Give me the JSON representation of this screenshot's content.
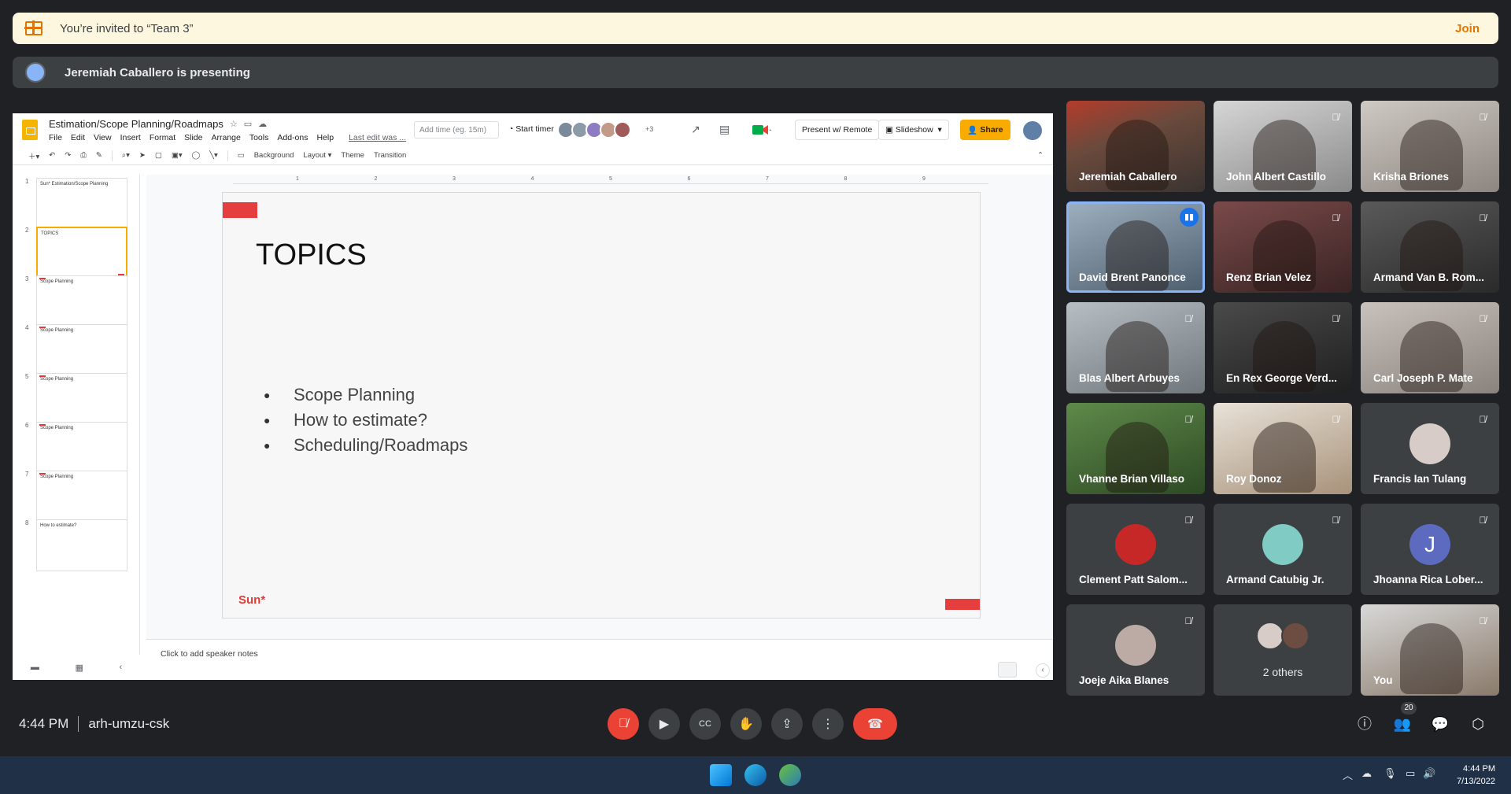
{
  "invite": {
    "text": "You’re invited to “Team 3”",
    "join_label": "Join"
  },
  "presenting": {
    "text": "Jeremiah Caballero is presenting"
  },
  "slides_app": {
    "doc_title": "Estimation/Scope Planning/Roadmaps",
    "menu": [
      "File",
      "Edit",
      "View",
      "Insert",
      "Format",
      "Slide",
      "Arrange",
      "Tools",
      "Add-ons",
      "Help"
    ],
    "last_edit": "Last edit was ...",
    "add_time_placeholder": "Add time (eg. 15m)",
    "start_timer": "Start timer",
    "plus_count": "+3",
    "present_remote": "Present w/ Remote",
    "slideshow": "Slideshow",
    "share": "Share",
    "toolbar": {
      "background": "Background",
      "layout": "Layout",
      "theme": "Theme",
      "transition": "Transition"
    },
    "ruler_ticks": [
      "1",
      "2",
      "3",
      "4",
      "5",
      "6",
      "7",
      "8",
      "9"
    ],
    "thumbnails": [
      {
        "num": "1",
        "title": "Sun* Estimation/Scope Planning"
      },
      {
        "num": "2",
        "title": "TOPICS"
      },
      {
        "num": "3",
        "title": "Scope Planning"
      },
      {
        "num": "4",
        "title": "Scope Planning"
      },
      {
        "num": "5",
        "title": "Scope Planning"
      },
      {
        "num": "6",
        "title": "Scope Planning"
      },
      {
        "num": "7",
        "title": "Scope Planning"
      },
      {
        "num": "8",
        "title": "How to estimate?"
      }
    ],
    "slide": {
      "heading": "TOPICS",
      "bullets": [
        "Scope Planning",
        "How to estimate?",
        "Scheduling/Roadmaps"
      ],
      "brand": "Sun*"
    },
    "speaker_notes": "Click to add speaker notes"
  },
  "participants": [
    {
      "name": "Jeremiah Caballero",
      "mode": "video",
      "muted": false
    },
    {
      "name": "John Albert Castillo",
      "mode": "video",
      "muted": true
    },
    {
      "name": "Krisha Briones",
      "mode": "video",
      "muted": true
    },
    {
      "name": "David Brent Panonce",
      "mode": "video",
      "muted": false,
      "speaking": true
    },
    {
      "name": "Renz Brian Velez",
      "mode": "video",
      "muted": true
    },
    {
      "name": "Armand Van B. Rom...",
      "mode": "video",
      "muted": true
    },
    {
      "name": "Blas Albert Arbuyes",
      "mode": "video",
      "muted": true
    },
    {
      "name": "En Rex George Verd...",
      "mode": "video",
      "muted": true
    },
    {
      "name": "Carl Joseph P. Mate",
      "mode": "video",
      "muted": true
    },
    {
      "name": "Vhanne Brian Villaso",
      "mode": "video",
      "muted": true
    },
    {
      "name": "Roy Donoz",
      "mode": "video",
      "muted": true
    },
    {
      "name": "Francis Ian Tulang",
      "mode": "avatar",
      "muted": true
    },
    {
      "name": "Clement Patt Salom...",
      "mode": "avatar",
      "muted": true
    },
    {
      "name": "Armand Catubig Jr.",
      "mode": "avatar",
      "muted": true
    },
    {
      "name": "Jhoanna Rica Lober...",
      "mode": "avatar",
      "muted": true,
      "initial": "J"
    },
    {
      "name": "Joeje Aika Blanes",
      "mode": "avatar",
      "muted": true
    },
    {
      "name": "2 others",
      "mode": "others"
    },
    {
      "name": "You",
      "mode": "video",
      "muted": true
    }
  ],
  "bottom": {
    "time": "4:44 PM",
    "meeting_code": "arh-umzu-csk",
    "people_count": "20"
  },
  "taskbar": {
    "time": "4:44 PM",
    "date": "7/13/2022"
  },
  "colors": {
    "accent_red": "#ea4335",
    "meet_bg": "#202124",
    "invite_bg": "#fef7e0",
    "invite_accent": "#e37400",
    "share_yellow": "#f9ab00",
    "speaking_blue": "#1a73e8"
  }
}
